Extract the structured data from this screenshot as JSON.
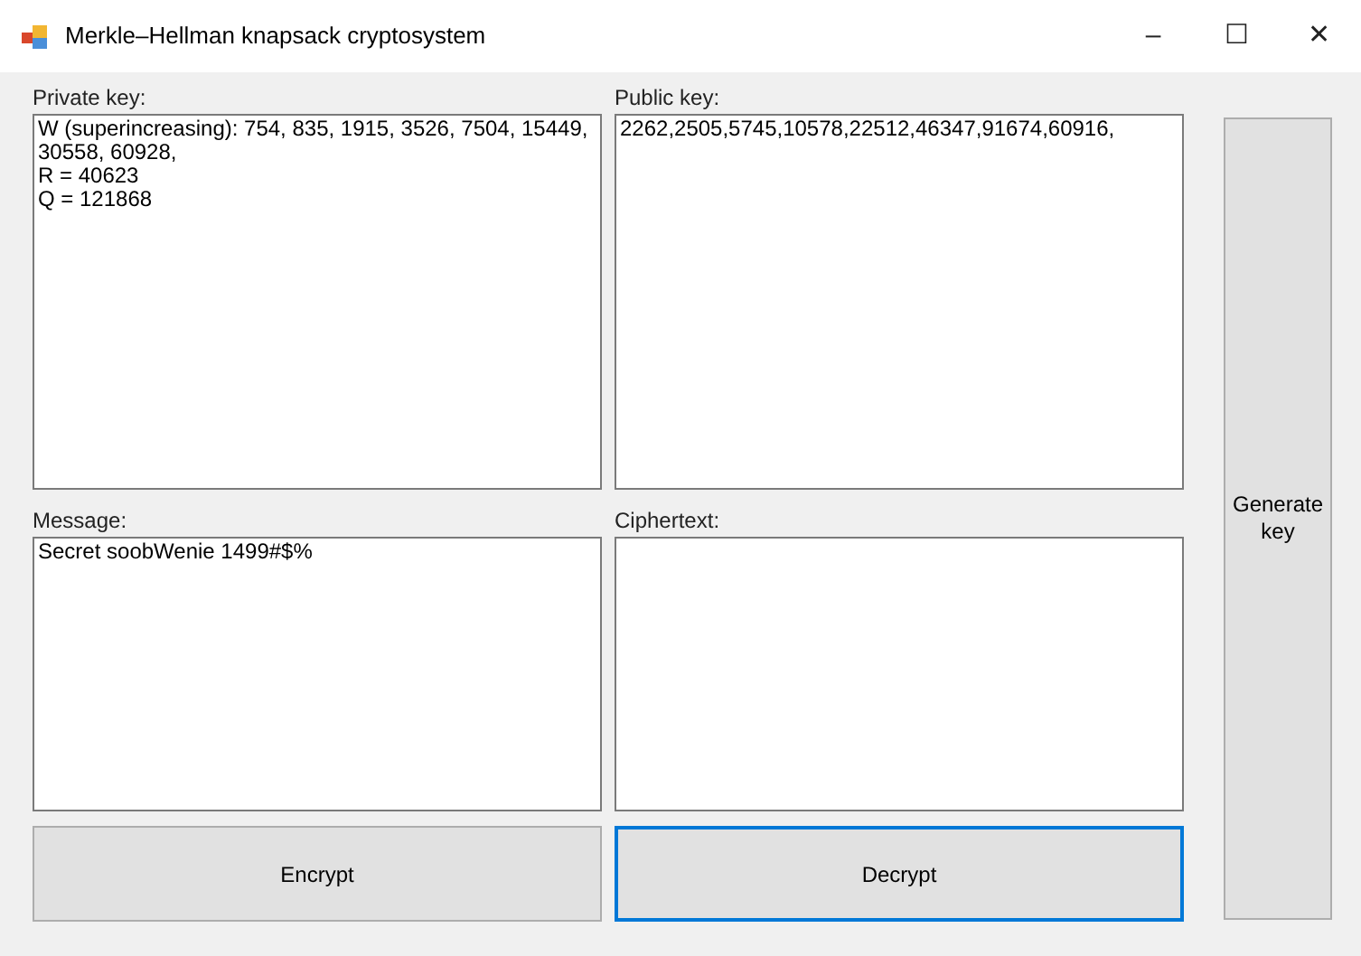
{
  "window": {
    "title": "Merkle–Hellman knapsack cryptosystem",
    "controls": [
      "–",
      "☐",
      "✕"
    ]
  },
  "fields": [
    {
      "label": "Private key:",
      "lines": [
        "W (superincreasing): 754, 835, 1915, 3526, 7504, 15449,",
        "30558, 60928,",
        "R = 40623",
        "Q = 121868"
      ]
    },
    {
      "label": "Public key:",
      "lines": [
        "2262,2505,5745,10578,22512,46347,91674,60916,"
      ]
    },
    {
      "label": "Message:",
      "lines": [
        "Secret soobWenie 1499#$%"
      ]
    },
    {
      "label": "Ciphertext:"
    }
  ],
  "buttons": [
    {
      "label": "Encrypt",
      "focused": false
    },
    {
      "label": "Decrypt",
      "focused": true
    }
  ],
  "side_button": {
    "label": "Generate key"
  }
}
